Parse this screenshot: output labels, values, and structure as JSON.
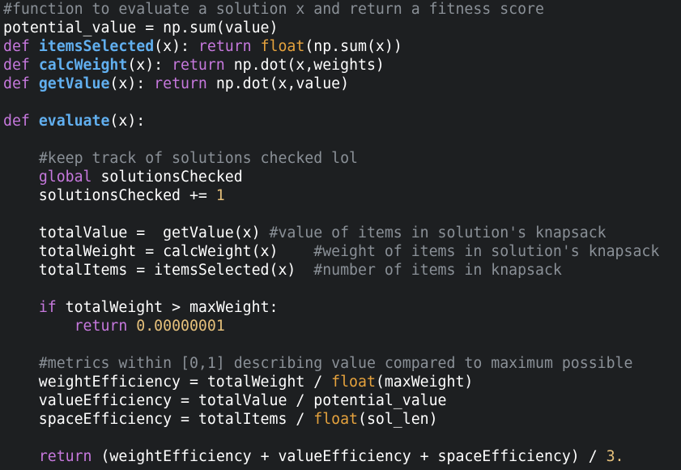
{
  "colors": {
    "background": "#1d1f21",
    "comment": "#8a9097",
    "keyword": "#c678dd",
    "function_name": "#61afef",
    "builtin": "#e5a23d",
    "number": "#e5c07b",
    "text": "#ffffff"
  },
  "code": {
    "lines": [
      [
        {
          "cls": "c",
          "text": "#function to evaluate a solution x and return a fitness score"
        }
      ],
      [
        {
          "cls": "t",
          "text": "potential_value = np.sum(value)"
        }
      ],
      [
        {
          "cls": "k",
          "text": "def "
        },
        {
          "cls": "f",
          "text": "itemsSelected"
        },
        {
          "cls": "t",
          "text": "(x): "
        },
        {
          "cls": "k",
          "text": "return "
        },
        {
          "cls": "b",
          "text": "float"
        },
        {
          "cls": "t",
          "text": "(np.sum(x))"
        }
      ],
      [
        {
          "cls": "k",
          "text": "def "
        },
        {
          "cls": "f",
          "text": "calcWeight"
        },
        {
          "cls": "t",
          "text": "(x): "
        },
        {
          "cls": "k",
          "text": "return "
        },
        {
          "cls": "t",
          "text": "np.dot(x,weights)"
        }
      ],
      [
        {
          "cls": "k",
          "text": "def "
        },
        {
          "cls": "f",
          "text": "getValue"
        },
        {
          "cls": "t",
          "text": "(x): "
        },
        {
          "cls": "k",
          "text": "return "
        },
        {
          "cls": "t",
          "text": "np.dot(x,value)"
        }
      ],
      [],
      [
        {
          "cls": "k",
          "text": "def "
        },
        {
          "cls": "f",
          "text": "evaluate"
        },
        {
          "cls": "t",
          "text": "(x):"
        }
      ],
      [],
      [
        {
          "cls": "t",
          "text": "    "
        },
        {
          "cls": "c",
          "text": "#keep track of solutions checked lol"
        }
      ],
      [
        {
          "cls": "t",
          "text": "    "
        },
        {
          "cls": "k",
          "text": "global "
        },
        {
          "cls": "t",
          "text": "solutionsChecked"
        }
      ],
      [
        {
          "cls": "t",
          "text": "    solutionsChecked += "
        },
        {
          "cls": "n",
          "text": "1"
        }
      ],
      [],
      [
        {
          "cls": "t",
          "text": "    totalValue =  getValue(x) "
        },
        {
          "cls": "c",
          "text": "#value of items in solution's knapsack"
        }
      ],
      [
        {
          "cls": "t",
          "text": "    totalWeight = calcWeight(x)    "
        },
        {
          "cls": "c",
          "text": "#weight of items in solution's knapsack"
        }
      ],
      [
        {
          "cls": "t",
          "text": "    totalItems = itemsSelected(x)  "
        },
        {
          "cls": "c",
          "text": "#number of items in knapsack"
        }
      ],
      [],
      [
        {
          "cls": "t",
          "text": "    "
        },
        {
          "cls": "k",
          "text": "if "
        },
        {
          "cls": "t",
          "text": "totalWeight > maxWeight:"
        }
      ],
      [
        {
          "cls": "t",
          "text": "        "
        },
        {
          "cls": "k",
          "text": "return "
        },
        {
          "cls": "n",
          "text": "0.00000001"
        }
      ],
      [],
      [
        {
          "cls": "t",
          "text": "    "
        },
        {
          "cls": "c",
          "text": "#metrics within [0,1] describing value compared to maximum possible"
        }
      ],
      [
        {
          "cls": "t",
          "text": "    weightEfficiency = totalWeight / "
        },
        {
          "cls": "b",
          "text": "float"
        },
        {
          "cls": "t",
          "text": "(maxWeight)"
        }
      ],
      [
        {
          "cls": "t",
          "text": "    valueEfficiency = totalValue / potential_value"
        }
      ],
      [
        {
          "cls": "t",
          "text": "    spaceEfficiency = totalItems / "
        },
        {
          "cls": "b",
          "text": "float"
        },
        {
          "cls": "t",
          "text": "(sol_len)"
        }
      ],
      [],
      [
        {
          "cls": "t",
          "text": "    "
        },
        {
          "cls": "k",
          "text": "return "
        },
        {
          "cls": "t",
          "text": "(weightEfficiency + valueEfficiency + spaceEfficiency) / "
        },
        {
          "cls": "n",
          "text": "3."
        }
      ]
    ]
  }
}
